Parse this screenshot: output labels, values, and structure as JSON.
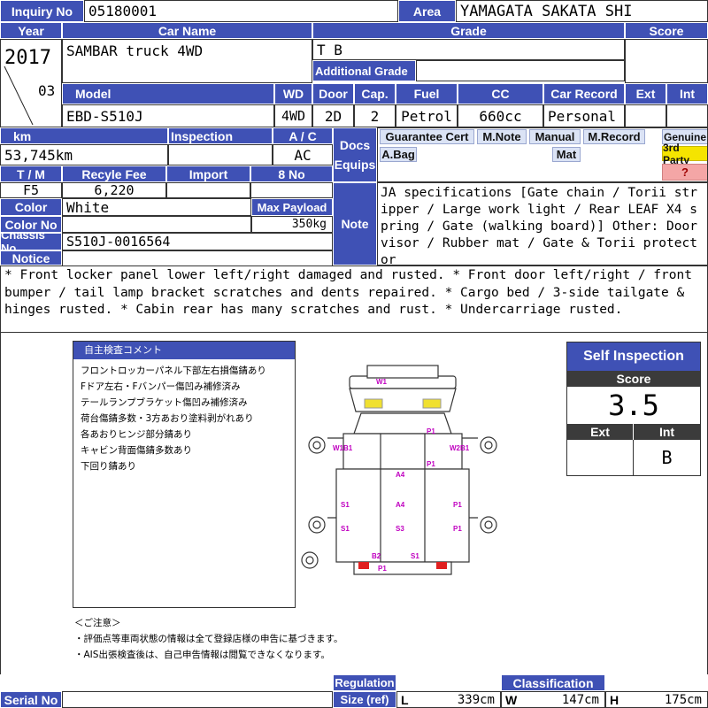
{
  "header": {
    "inquiry_label": "Inquiry No",
    "inquiry_no": "05180001",
    "area_label": "Area",
    "area": "YAMAGATA SAKATA SHI"
  },
  "labels": {
    "year": "Year",
    "car_name": "Car Name",
    "grade": "Grade",
    "score": "Score",
    "additional_grade": "Additional Grade",
    "model": "Model",
    "wd": "WD",
    "door": "Door",
    "cap": "Cap.",
    "fuel": "Fuel",
    "cc": "CC",
    "car_record": "Car Record",
    "ext": "Ext",
    "int": "Int",
    "km": "km",
    "inspection": "Inspection",
    "ac": "A / C",
    "docs": "Docs",
    "equips": "Equips",
    "tm": "T / M",
    "recycle_fee": "Recyle Fee",
    "import": "Import",
    "no8": "8 No",
    "color": "Color",
    "max_payload": "Max Payload",
    "color_no": "Color No",
    "note": "Note",
    "chassis_no": "Chassis No",
    "notice": "Notice",
    "serial_no": "Serial No",
    "regulation": "Regulation",
    "size_ref": "Size (ref)",
    "classification": "Classification",
    "l": "L",
    "w": "W",
    "h": "H"
  },
  "vehicle": {
    "year": "2017",
    "month": "03",
    "car_name": "SAMBAR truck 4WD",
    "grade": "T B",
    "model": "EBD-S510J",
    "wd": "4WD",
    "door": "2D",
    "cap": "2",
    "fuel": "Petrol",
    "cc": "660cc",
    "car_record": "Personal",
    "km": "53,745km",
    "ac": "AC",
    "tm": "F5",
    "recycle_fee": "6,220",
    "color": "White",
    "max_payload": "350kg",
    "chassis_no": "S510J-0016564",
    "size_l": "339cm",
    "size_w": "147cm",
    "size_h": "175cm"
  },
  "equip_tags": {
    "guarantee": "Guarantee Cert",
    "mnote": "M.Note",
    "manual": "Manual",
    "mrecord": "M.Record",
    "abag": "A.Bag",
    "mat": "Mat",
    "genuine": "Genuine",
    "third_party": "3rd Party",
    "unknown": "?"
  },
  "colors": {
    "header": "#3f51b5",
    "tag_bg": "#dbe3f5",
    "third_party": "#f5e400",
    "unknown_bg": "#f4a6a6",
    "damage_red": "#e02020",
    "mark_yellow": "#f0e030"
  },
  "note_text": "JA specifications [Gate chain / Torii stripper / Large work light / Rear LEAF X4 spring / Gate (walking board)] Other: Door visor / Rubber mat / Gate & Torii protector",
  "notice_text": "* Front locker panel lower left/right damaged and rusted. * Front door left/right / front bumper / tail lamp bracket scratches and dents repaired. * Cargo bed / 3-side tailgate & hinges rusted. * Cabin rear has many scratches and rust. * Undercarriage rusted.",
  "jp_comment": {
    "title": "自主検査コメント",
    "lines": [
      "フロントロッカーパネル下部左右損傷錆あり",
      "Fドア左右・Fバンパー傷凹み補修済み",
      "テールランプブラケット傷凹み補修済み",
      "荷台傷錆多数・3方あおり塗料剥がれあり",
      "各あおりヒンジ部分錆あり",
      "キャビン背面傷錆多数あり",
      "下回り錆あり"
    ]
  },
  "caution": {
    "title": "＜ご注意＞",
    "lines": [
      "・評価点等車両状態の情報は全て登録店様の申告に基づきます。",
      "・AIS出張検査後は、自己申告情報は閲覧できなくなります。"
    ]
  },
  "diagram_marks": {
    "w1": "W1",
    "p1_a": "P1",
    "w1b1": "W1B1",
    "w2b1": "W2B1",
    "p1_b": "P1",
    "a4_a": "A4",
    "s1_a": "S1",
    "a4_b": "A4",
    "p1_c": "P1",
    "s1_b": "S1",
    "s3": "S3",
    "p1_d": "P1",
    "b2": "B2",
    "s1_c": "S1",
    "p1_e": "P1"
  },
  "self_inspection": {
    "title": "Self Inspection",
    "score_label": "Score",
    "score": "3.5",
    "ext_label": "Ext",
    "int_label": "Int",
    "ext": "",
    "int": "B"
  }
}
